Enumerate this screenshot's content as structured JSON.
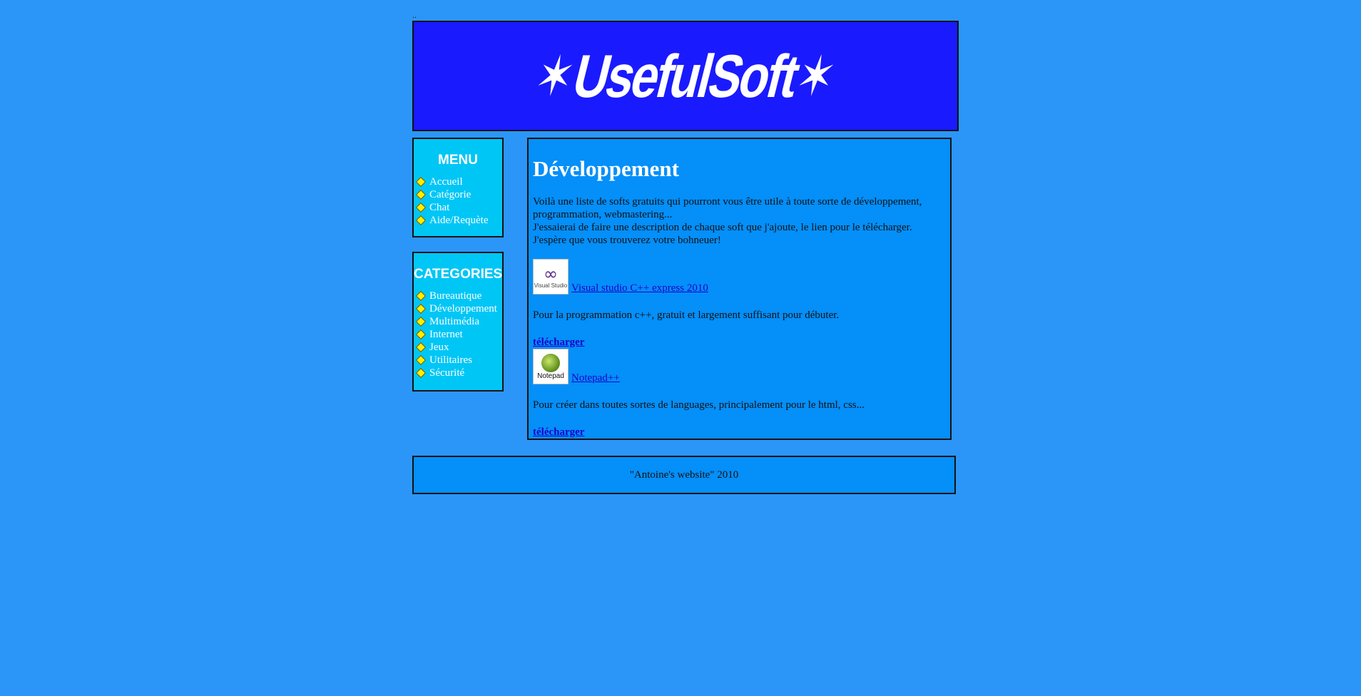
{
  "top_marker": "..",
  "banner": {
    "logo_text": "UsefulSoft",
    "logo_star": "✶"
  },
  "menu": {
    "title": "MENU",
    "items": [
      {
        "label": "Accueil"
      },
      {
        "label": "Catégorie"
      },
      {
        "label": "Chat"
      },
      {
        "label": "Aide/Requète"
      }
    ]
  },
  "categories": {
    "title": "CATEGORIES",
    "items": [
      {
        "label": "Bureautique"
      },
      {
        "label": "Développement"
      },
      {
        "label": "Multimédia"
      },
      {
        "label": "Internet"
      },
      {
        "label": "Jeux"
      },
      {
        "label": "Utilitaires"
      },
      {
        "label": "Sécurité"
      }
    ]
  },
  "content": {
    "title": "Développement",
    "intro_lines": [
      "Voilà une liste de softs gratuits qui pourront vous être utile à toute sorte de développement,",
      "programmation, webmastering...",
      "J'essaierai de faire une description de chaque soft que j'ajoute, le lien pour le télécharger.",
      "J'espère que vous trouverez votre bohneuer!"
    ],
    "softs": [
      {
        "name": "Visual studio C++ express 2010",
        "logo_caption": "Visual Studio",
        "logo_symbol": "∞",
        "description": "Pour la programmation c++, gratuit et largement suffisant pour débuter.",
        "download_label": "télécharger"
      },
      {
        "name": "Notepad++",
        "logo_caption": "Notepad",
        "description": "Pour créer dans toutes sortes de languages, principalement pour le html, css...",
        "download_label": "télécharger"
      }
    ]
  },
  "footer": {
    "text": "\"Antoine's website\" 2010"
  },
  "colors": {
    "page_bg": "#2b96f8",
    "banner_bg": "#1a1aff",
    "sidebar_bg": "#00c6f6",
    "content_bg": "#048ff9",
    "link": "#1a00c8",
    "bullet": "#ffee00"
  }
}
